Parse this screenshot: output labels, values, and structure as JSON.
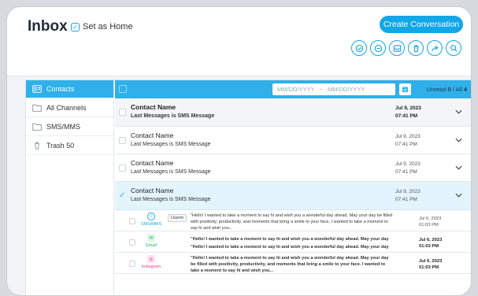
{
  "header": {
    "title": "Inbox",
    "set_home_label": "Set as Home",
    "create_label": "Create Conversation",
    "actions": [
      "check-circle-icon",
      "minus-circle-icon",
      "inbox-icon",
      "trash-icon",
      "forward-icon",
      "search-icon"
    ]
  },
  "sidebar": {
    "items": [
      {
        "label": "Contacts",
        "icon": "contacts-icon"
      },
      {
        "label": "All Channels",
        "icon": "folder-icon"
      },
      {
        "label": "SMS/MMS",
        "icon": "folder-icon"
      },
      {
        "label": "Trash  50",
        "icon": "trash-icon"
      }
    ]
  },
  "filter": {
    "date_from_placeholder": "MM/DD/YYYY",
    "date_sep": "~",
    "date_to_placeholder": "MM/DD/YYYY",
    "unread_prefix": "Unread",
    "unread_count": "0",
    "all_sep": "/ All",
    "all_count": "4"
  },
  "rows": [
    {
      "name": "Contact Name",
      "message": "Last Messages is SMS Message",
      "date": "Jul 9, 2023",
      "time": "07:41 PM"
    },
    {
      "name": "Contact Name",
      "message": "Last Messages is SMS Message",
      "date": "Jul 9, 2023",
      "time": "07:41 PM"
    },
    {
      "name": "Contact Name",
      "message": "Last Messages is SMS Message",
      "date": "Jul 9, 2023",
      "time": "07:41 PM"
    },
    {
      "name": "Contact Name",
      "message": "Last Messages is SMS Message",
      "date": "Jul 9, 2023",
      "time": "07:41 PM"
    }
  ],
  "subrows": [
    {
      "channel": "SMS/MMS",
      "badge": "Userm",
      "lines": [
        "\"Hello! I wanted to take a moment to say hi and wish you a wonderful day ahead. May your day be filled",
        "with positivity, productivity, and moments that bring a smile to your face. I wanted to take a moment to",
        "say hi and wish you..."
      ],
      "date": "Jul 6, 2023",
      "time": "01:03 PM"
    },
    {
      "channel": "Email",
      "lines": [
        "\"Hello! I wanted to take a moment to say hi and wish you a wonderful day ahead. May your day",
        "\"Hello! I wanted to take a moment to say hi and wish you a wonderful day ahead. May your day"
      ],
      "date": "Jul 6, 2023",
      "time": "01:03 PM"
    },
    {
      "channel": "Instagram",
      "lines": [
        "\"Hello! I wanted to take a moment to say hi and wish you a wonderful day ahead. May your day",
        "be filled with positivity, productivity, and moments that bring a smile to your face. I wanted to",
        "take a moment to say hi and wish you..."
      ],
      "date": "Jul 6, 2023",
      "time": "01:03 PM"
    }
  ],
  "colors": {
    "accent": "#2fb0ea",
    "selected_row": "#e3f4fc",
    "email": "#1db56f",
    "instagram": "#e23b8d"
  }
}
